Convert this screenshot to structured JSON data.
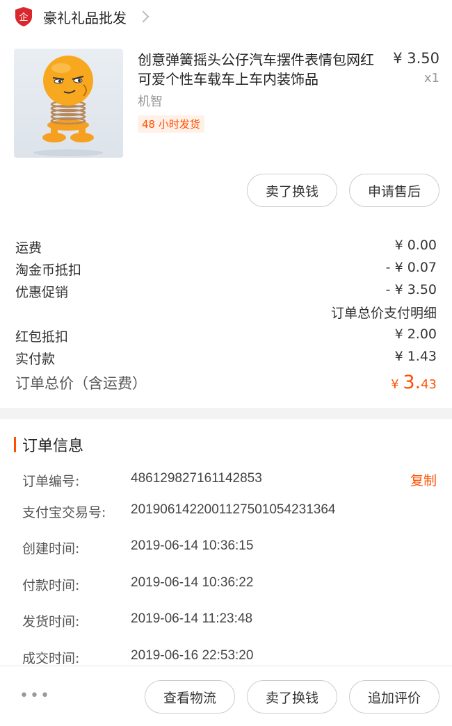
{
  "shop": {
    "name": "豪礼礼品批发",
    "badge_icon": "enterprise-badge-icon",
    "badge_char": "企"
  },
  "product": {
    "title": "创意弹簧摇头公仔汽车摆件表情包网红可爱个性车载车上车内装饰品",
    "price": "¥ 3.50",
    "qty": "x1",
    "spec": "机智",
    "tag": "48 小时发货"
  },
  "item_actions": {
    "sell": "卖了换钱",
    "after_sale": "申请售后"
  },
  "fees": [
    {
      "label": "运费",
      "value": "¥ 0.00"
    },
    {
      "label": "淘金币抵扣",
      "value": "- ¥ 0.07"
    },
    {
      "label": "优惠促销",
      "value": "- ¥ 3.50"
    }
  ],
  "pay_detail": "订单总价支付明细",
  "payments": [
    {
      "label": "红包抵扣",
      "value": "¥ 2.00"
    },
    {
      "label": "实付款",
      "value": "¥ 1.43"
    }
  ],
  "total": {
    "label": "订单总价（含运费）",
    "symbol": "¥ ",
    "int": "3.",
    "dec": "43"
  },
  "order_info": {
    "title": "订单信息",
    "copy": "复制",
    "rows": [
      {
        "label": "订单编号:",
        "value": "486129827161142853"
      },
      {
        "label": "支付宝交易号:",
        "value": "2019061422001127501054231364"
      },
      {
        "label": "创建时间:",
        "value": "2019-06-14 10:36:15"
      },
      {
        "label": "付款时间:",
        "value": "2019-06-14 10:36:22"
      },
      {
        "label": "发货时间:",
        "value": "2019-06-14 11:23:48"
      },
      {
        "label": "成交时间:",
        "value": "2019-06-16 22:53:20"
      }
    ]
  },
  "bottom": {
    "more": "•••",
    "logistics": "查看物流",
    "sell": "卖了换钱",
    "review": "追加评价"
  },
  "colors": {
    "accent": "#ff5000",
    "brand_red": "#d9272e"
  }
}
